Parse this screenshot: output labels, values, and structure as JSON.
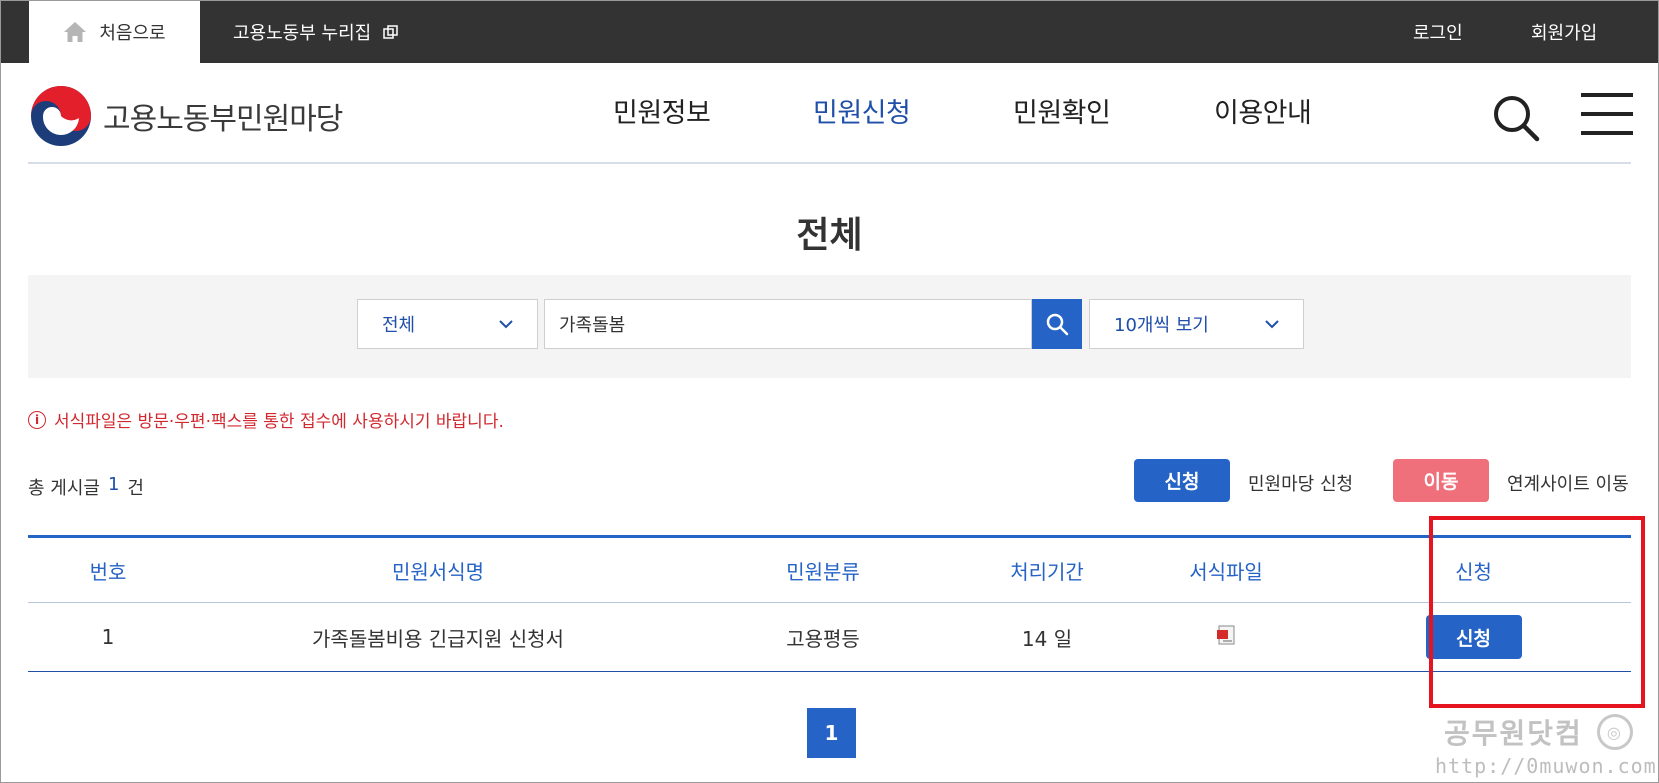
{
  "topbar": {
    "home_label": "처음으로",
    "nuri_label": "고용노동부 누리집",
    "login_label": "로그인",
    "join_label": "회원가입"
  },
  "header": {
    "logo_text": "고용노동부민원마당",
    "nav": [
      {
        "label": "민원정보",
        "active": false
      },
      {
        "label": "민원신청",
        "active": true
      },
      {
        "label": "민원확인",
        "active": false
      },
      {
        "label": "이용안내",
        "active": false
      }
    ]
  },
  "page": {
    "title": "전체"
  },
  "search": {
    "category_value": "전체",
    "keyword_value": "가족돌봄",
    "per_page_value": "10개씩 보기"
  },
  "notice": {
    "icon": "i",
    "text": "서식파일은 방문·우편·팩스를 통한 접수에 사용하시기 바랍니다."
  },
  "summary": {
    "total_prefix": "총 게시글",
    "total_count": "1",
    "total_suffix": "건"
  },
  "legend": {
    "apply_button": "신청",
    "apply_desc": "민원마당 신청",
    "move_button": "이동",
    "move_desc": "연계사이트 이동"
  },
  "table": {
    "headers": [
      "번호",
      "민원서식명",
      "민원분류",
      "처리기간",
      "서식파일",
      "신청"
    ],
    "rows": [
      {
        "no": "1",
        "name": "가족돌봄비용 긴급지원 신청서",
        "category": "고용평등",
        "period": "14 일",
        "file_icon": "hwp-file-icon",
        "apply": "신청"
      }
    ]
  },
  "pagination": {
    "current": "1"
  },
  "watermark": {
    "name": "공무원닷컴",
    "url": "http://0muwon.com"
  },
  "colors": {
    "primary": "#2563c6",
    "nav_active": "#1f4fa8",
    "move": "#ef6f7a",
    "notice": "#d1292f",
    "highlight": "#e5141e",
    "topbar": "#333333"
  }
}
